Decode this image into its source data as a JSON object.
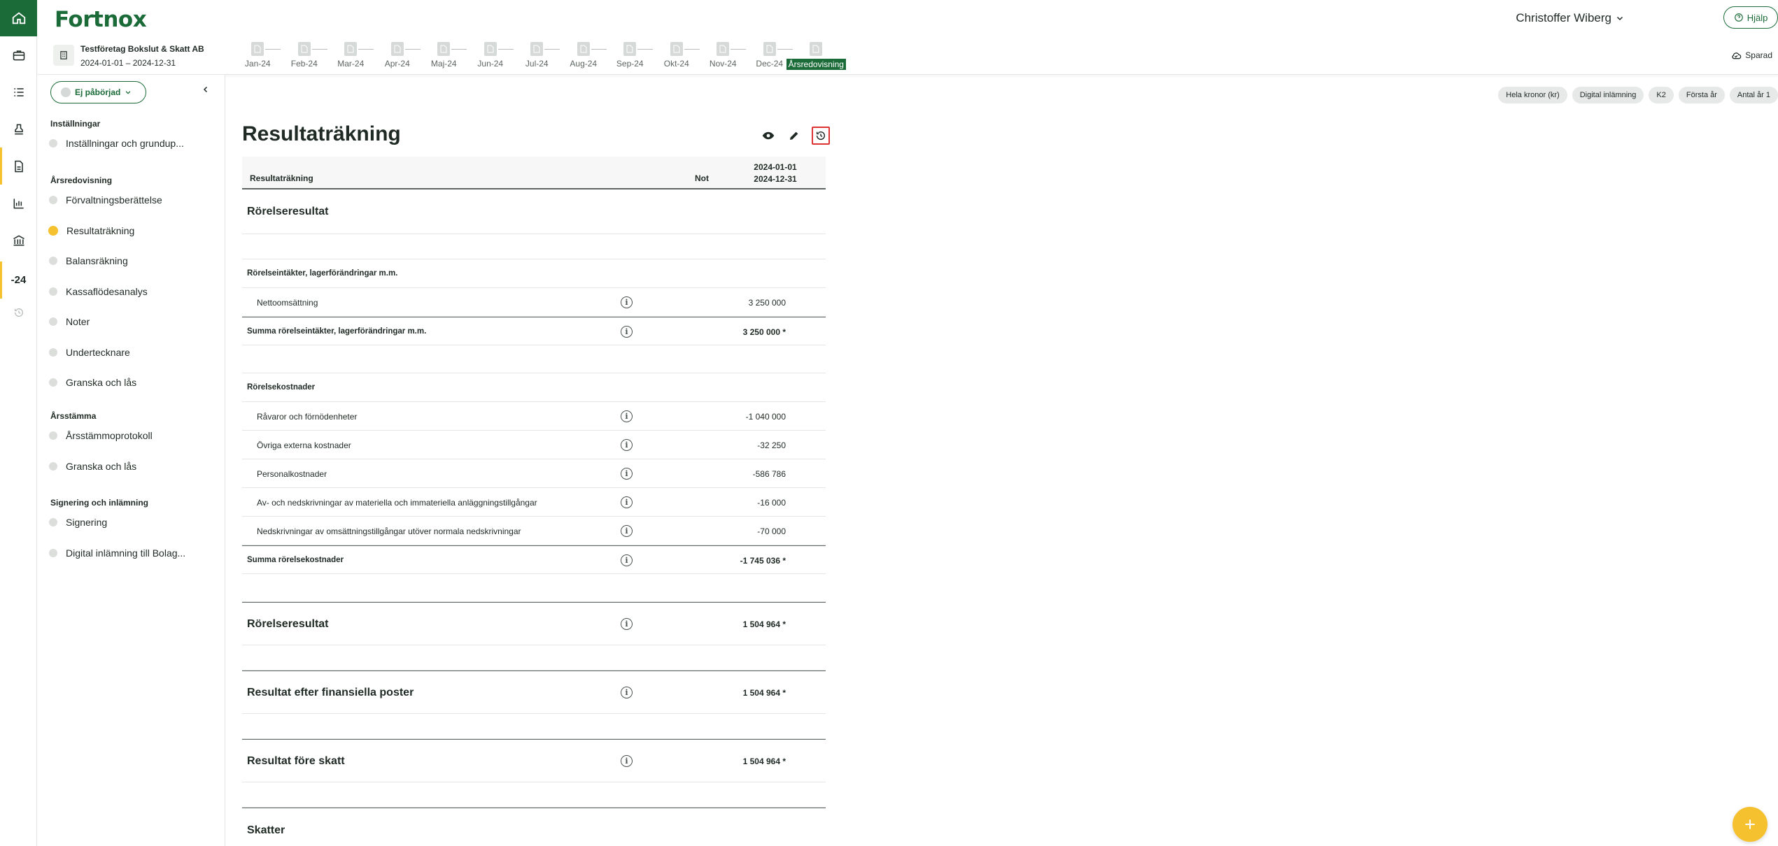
{
  "app": {
    "logo": "Fortnox",
    "user_name": "Christoffer Wiberg",
    "help_label": "Hjälp",
    "rail_year": "-24"
  },
  "company": {
    "name": "Testföretag Bokslut & Skatt AB",
    "period": "2024-01-01 – 2024-12-31",
    "saved_label": "Sparad"
  },
  "months": [
    "Jan-24",
    "Feb-24",
    "Mar-24",
    "Apr-24",
    "Maj-24",
    "Jun-24",
    "Jul-24",
    "Aug-24",
    "Sep-24",
    "Okt-24",
    "Nov-24",
    "Dec-24",
    "Årsredovisning"
  ],
  "sidebar": {
    "status": "Ej påbörjad",
    "sections": [
      {
        "title": "Inställningar",
        "items": [
          "Inställningar och grundup..."
        ]
      },
      {
        "title": "Årsredovisning",
        "items": [
          "Förvaltningsberättelse",
          "Resultaträkning",
          "Balansräkning",
          "Kassaflödesanalys",
          "Noter",
          "Undertecknare",
          "Granska och lås"
        ]
      },
      {
        "title": "Årsstämma",
        "items": [
          "Årsstämmoprotokoll",
          "Granska och lås"
        ]
      },
      {
        "title": "Signering och inlämning",
        "items": [
          "Signering",
          "Digital inlämning till Bolag..."
        ]
      }
    ]
  },
  "tags": [
    "Hela kronor (kr)",
    "Digital inlämning",
    "K2",
    "Första år",
    "Antal år 1"
  ],
  "page": {
    "title": "Resultaträkning"
  },
  "report": {
    "header": {
      "col_label": "Resultaträkning",
      "col_note": "Not",
      "col_period_start": "2024-01-01",
      "col_period_end": "2024-12-31"
    },
    "rows": [
      {
        "label": "Rörelseresultat",
        "type": "big",
        "value": ""
      },
      {
        "label": "",
        "type": "blank",
        "value": ""
      },
      {
        "label": "Rörelseintäkter, lagerförändringar m.m.",
        "type": "sub",
        "value": ""
      },
      {
        "label": "Nettoomsättning",
        "type": "item",
        "value": "3 250 000"
      },
      {
        "label": "Summa rörelseintäkter, lagerförändringar m.m.",
        "type": "sum",
        "value": "3 250 000 *"
      },
      {
        "label": "",
        "type": "blank",
        "value": ""
      },
      {
        "label": "Rörelsekostnader",
        "type": "sub",
        "value": ""
      },
      {
        "label": "Råvaror och förnödenheter",
        "type": "item",
        "value": "-1 040 000"
      },
      {
        "label": "Övriga externa kostnader",
        "type": "item",
        "value": "-32 250"
      },
      {
        "label": "Personalkostnader",
        "type": "item",
        "value": "-586 786"
      },
      {
        "label": "Av- och nedskrivningar av materiella och immateriella anläggningstillgångar",
        "type": "item",
        "value": "-16 000"
      },
      {
        "label": "Nedskrivningar av omsättningstillgångar utöver normala nedskrivningar",
        "type": "item",
        "value": "-70 000"
      },
      {
        "label": "Summa rörelsekostnader",
        "type": "sum",
        "value": "-1 745 036 *"
      },
      {
        "label": "",
        "type": "blank",
        "value": ""
      },
      {
        "label": "Rörelseresultat",
        "type": "bigtotal",
        "value": "1 504 964 *"
      },
      {
        "label": "",
        "type": "blank",
        "value": ""
      },
      {
        "label": "Resultat efter finansiella poster",
        "type": "bigtotal",
        "value": "1 504 964 *"
      },
      {
        "label": "",
        "type": "blank",
        "value": ""
      },
      {
        "label": "Resultat före skatt",
        "type": "bigtotal",
        "value": "1 504 964 *"
      },
      {
        "label": "",
        "type": "blank",
        "value": ""
      },
      {
        "label": "Skatter",
        "type": "big",
        "value": ""
      }
    ]
  },
  "colors": {
    "brand_green": "#1b6b38",
    "accent_yellow": "#f6c12f",
    "highlight_red": "#dd3333"
  }
}
